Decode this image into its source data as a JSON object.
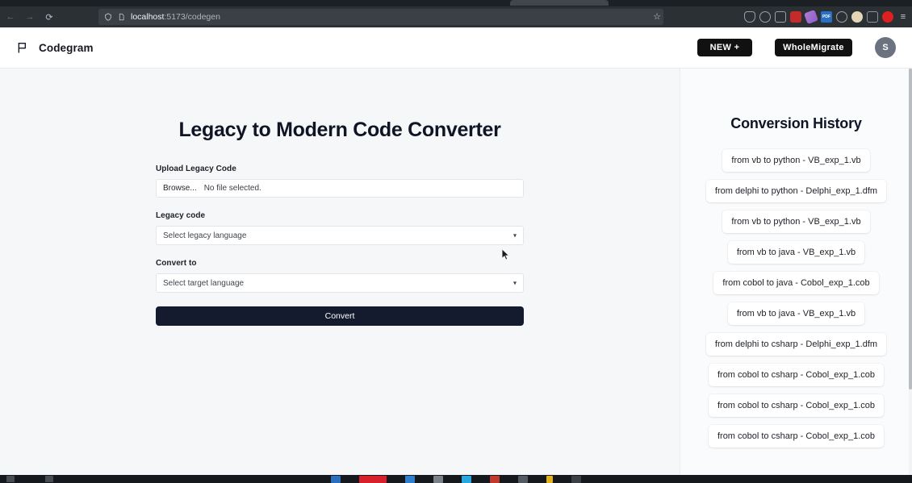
{
  "browser": {
    "back_icon": "back-arrow-icon",
    "forward_icon": "forward-arrow-icon",
    "reload_icon": "reload-icon",
    "shield_icon": "shield-icon",
    "page_icon": "page-icon",
    "url_host": "localhost",
    "url_path": ":5173/codegen",
    "bookmark_icon": "star-icon",
    "extensions": [
      {
        "name": "pocket-icon",
        "glyph": ""
      },
      {
        "name": "account-icon",
        "glyph": ""
      },
      {
        "name": "thumbs-up-icon",
        "glyph": ""
      },
      {
        "name": "notification-badge-icon",
        "glyph": ""
      },
      {
        "name": "highlighter-icon",
        "glyph": ""
      },
      {
        "name": "pdf-extension-icon",
        "glyph": "PDF"
      },
      {
        "name": "adblock-icon",
        "glyph": ""
      },
      {
        "name": "profile-extension-icon",
        "glyph": ""
      },
      {
        "name": "pause-extension-icon",
        "glyph": ""
      },
      {
        "name": "record-icon",
        "glyph": ""
      },
      {
        "name": "hamburger-menu-icon",
        "glyph": "≡"
      }
    ]
  },
  "app": {
    "brand": {
      "logo_icon": "flag-icon",
      "name": "Codegram"
    },
    "header": {
      "new_button": "NEW +",
      "whole_migrate_button": "WholeMigrate",
      "avatar_initial": "S"
    },
    "main": {
      "title": "Legacy to Modern Code Converter",
      "upload_label": "Upload Legacy Code",
      "file_browse_label": "Browse...",
      "file_status": "No file selected.",
      "legacy_label": "Legacy code",
      "legacy_select_value": "Select legacy language",
      "target_label": "Convert to",
      "target_select_value": "Select target language",
      "convert_button": "Convert",
      "caret_icon": "chevron-down-icon"
    },
    "history": {
      "title": "Conversion History",
      "items": [
        "from vb to python - VB_exp_1.vb",
        "from delphi to python - Delphi_exp_1.dfm",
        "from vb to python - VB_exp_1.vb",
        "from vb to java - VB_exp_1.vb",
        "from cobol to java - Cobol_exp_1.cob",
        "from vb to java - VB_exp_1.vb",
        "from delphi to csharp - Delphi_exp_1.dfm",
        "from cobol to csharp - Cobol_exp_1.cob",
        "from cobol to csharp - Cobol_exp_1.cob",
        "from cobol to csharp - Cobol_exp_1.cob"
      ]
    }
  },
  "colors": {
    "accent_dark": "#141b2e",
    "button_black": "#111111",
    "main_bg": "#f6f7f8",
    "sidebar_bg": "#fafbfc",
    "avatar_bg": "#6b7280"
  }
}
